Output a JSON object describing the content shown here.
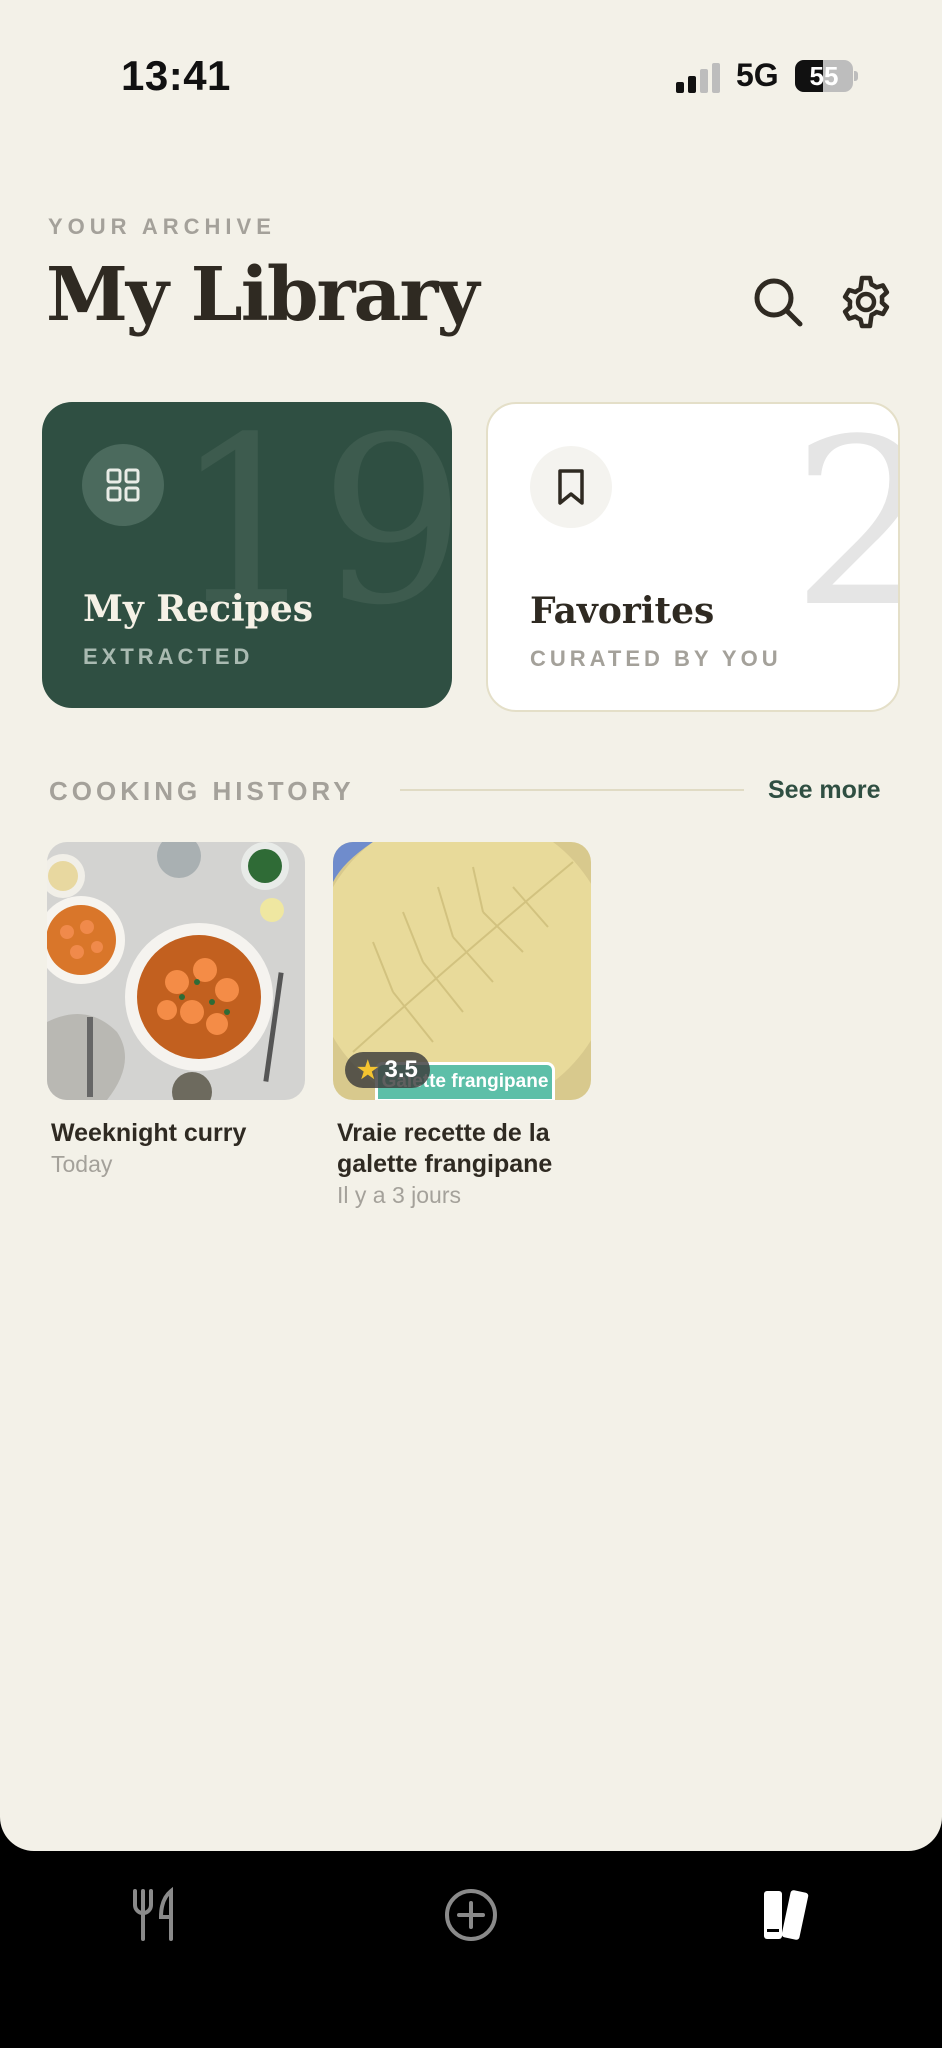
{
  "status_bar": {
    "time": "13:41",
    "network": "5G",
    "battery": "55"
  },
  "header": {
    "eyebrow": "YOUR ARCHIVE",
    "title": "My Library",
    "search_icon": "search-icon",
    "settings_icon": "gear-icon"
  },
  "cards": {
    "recipes": {
      "count": "19",
      "title": "My Recipes",
      "subtitle": "EXTRACTED",
      "icon": "grid-icon",
      "color": "#2f4f42"
    },
    "favorites": {
      "count": "2",
      "title": "Favorites",
      "subtitle": "CURATED BY YOU",
      "icon": "bookmark-icon",
      "color": "#ffffff"
    }
  },
  "history": {
    "label": "COOKING HISTORY",
    "see_more": "See more",
    "items": [
      {
        "title": "Weeknight curry",
        "date": "Today"
      },
      {
        "title": "Vraie recette de la galette frangipane",
        "date": "Il y a 3 jours",
        "rating": "3.5",
        "tag": "Galette frangipane"
      }
    ]
  },
  "tabbar": {
    "tabs": [
      {
        "icon": "fork-knife-icon",
        "active": false
      },
      {
        "icon": "add-circle-icon",
        "active": false
      },
      {
        "icon": "library-books-icon",
        "active": true
      }
    ]
  },
  "colors": {
    "background": "#f3f1e8",
    "accent": "#2f4f42",
    "muted": "#a4a19a",
    "text": "#2f2a22"
  }
}
